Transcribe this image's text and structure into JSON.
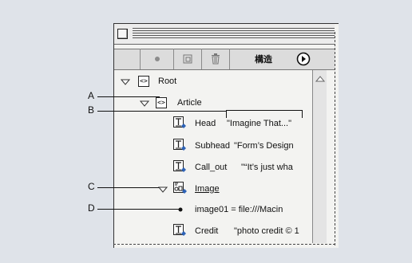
{
  "toolbar": {
    "structure_label": "構造"
  },
  "tree": {
    "root_label": "Root",
    "article_label": "Article",
    "rows": [
      {
        "tag": "Head",
        "value": "\"Imagine That...\""
      },
      {
        "tag": "Subhead",
        "value": "\"Form’s Design"
      },
      {
        "tag": "Call_out",
        "value": "\"“It’s just wha"
      }
    ],
    "image_label": "Image",
    "attribute_text": "image01 = file:///Macin",
    "credit": {
      "tag": "Credit",
      "value": "\"photo credit © 1"
    }
  },
  "callouts": [
    "A",
    "B",
    "C",
    "D"
  ],
  "icons": {
    "close": "close-box-icon",
    "dot": "new-attribute-icon",
    "page": "page-icon",
    "trash": "trash-icon",
    "menu": "panel-menu-arrow-icon"
  }
}
